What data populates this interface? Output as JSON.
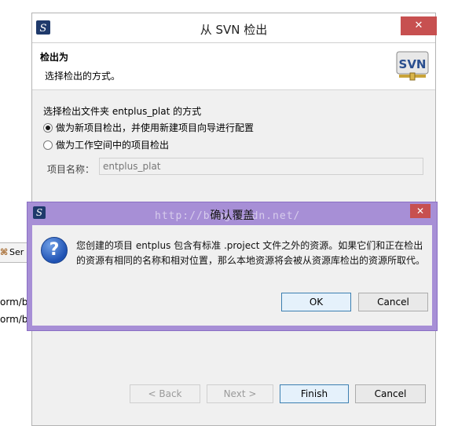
{
  "background": {
    "tab_label": "Ser",
    "lines": [
      "orm/b",
      "orm/b"
    ]
  },
  "window": {
    "title": "从 SVN 检出",
    "close_glyph": "✕",
    "header": {
      "title": "检出为",
      "subtitle": "选择检出的方式。",
      "logo_text": "SVN"
    },
    "folder_label": "选择检出文件夹 entplus_plat 的方式",
    "radio_options": [
      {
        "label": "做为新项目检出，并使用新建项目向导进行配置",
        "checked": true
      },
      {
        "label": "做为工作空间中的项目检出",
        "checked": false
      }
    ],
    "project_name_label": "项目名称：",
    "project_name_value": "entplus_plat",
    "buttons": {
      "back": "< Back",
      "next": "Next >",
      "finish": "Finish",
      "cancel": "Cancel"
    }
  },
  "confirm": {
    "title": "确认覆盖",
    "close_glyph": "✕",
    "watermark": "http://blog.csdn.net/",
    "message": "您创建的项目 entplus 包含有标准 .project 文件之外的资源。如果它们和正在检出的资源有相同的名称和相对位置，那么本地资源将会被从资源库检出的资源所取代。",
    "icon_glyph": "?",
    "ok": "OK",
    "cancel": "Cancel"
  },
  "colors": {
    "dialog_frame": "#a78fd6",
    "close_red": "#c75050"
  }
}
